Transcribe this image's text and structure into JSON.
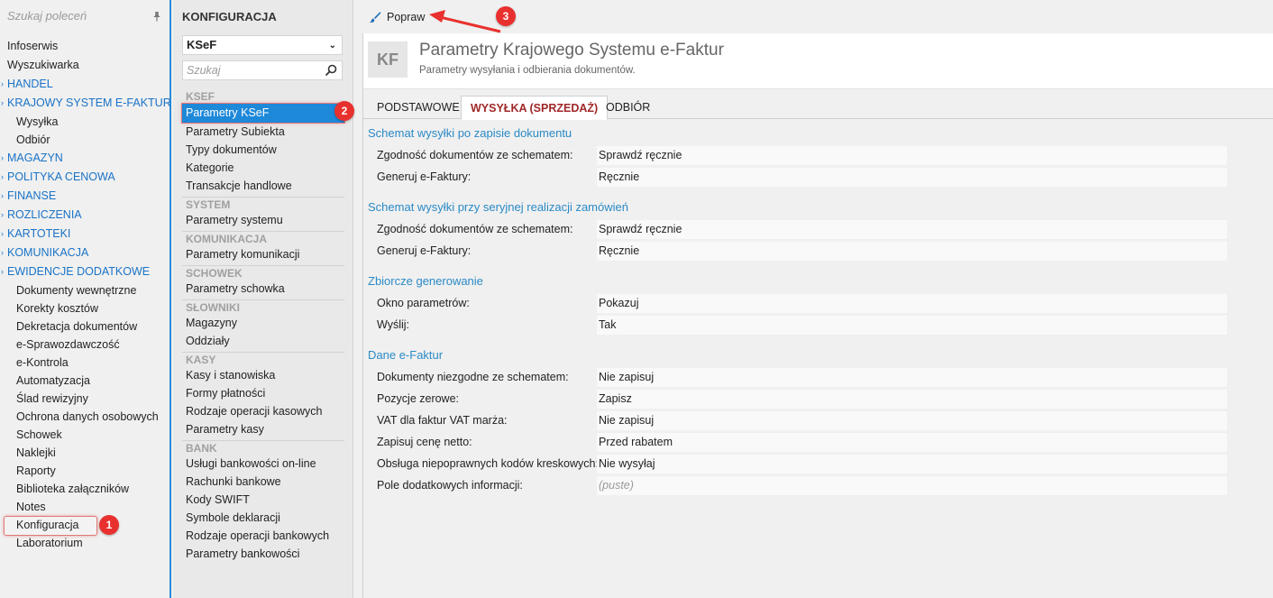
{
  "leftnav": {
    "search_placeholder": "Szukaj poleceń",
    "items": [
      {
        "label": "Infoserwis",
        "kind": "plain"
      },
      {
        "label": "Wyszukiwarka",
        "kind": "plain"
      },
      {
        "label": "HANDEL",
        "kind": "section"
      },
      {
        "label": "KRAJOWY SYSTEM E-FAKTUR",
        "kind": "section"
      },
      {
        "label": "Wysyłka",
        "kind": "sub"
      },
      {
        "label": "Odbiór",
        "kind": "sub"
      },
      {
        "label": "MAGAZYN",
        "kind": "section"
      },
      {
        "label": "POLITYKA CENOWA",
        "kind": "section"
      },
      {
        "label": "FINANSE",
        "kind": "section"
      },
      {
        "label": "ROZLICZENIA",
        "kind": "section"
      },
      {
        "label": "KARTOTEKI",
        "kind": "section"
      },
      {
        "label": "KOMUNIKACJA",
        "kind": "section"
      },
      {
        "label": "EWIDENCJE DODATKOWE",
        "kind": "section"
      },
      {
        "label": "Dokumenty wewnętrzne",
        "kind": "sub"
      },
      {
        "label": "Korekty kosztów",
        "kind": "sub"
      },
      {
        "label": "Dekretacja dokumentów",
        "kind": "sub"
      },
      {
        "label": "e-Sprawozdawczość",
        "kind": "sub"
      },
      {
        "label": "e-Kontrola",
        "kind": "sub"
      },
      {
        "label": "Automatyzacja",
        "kind": "sub"
      },
      {
        "label": "Ślad rewizyjny",
        "kind": "sub"
      },
      {
        "label": "Ochrona danych osobowych",
        "kind": "sub"
      },
      {
        "label": "Schowek",
        "kind": "sub"
      },
      {
        "label": "Naklejki",
        "kind": "sub"
      },
      {
        "label": "Raporty",
        "kind": "sub"
      },
      {
        "label": "Biblioteka załączników",
        "kind": "sub"
      },
      {
        "label": "Notes",
        "kind": "sub"
      },
      {
        "label": "Konfiguracja",
        "kind": "sub"
      },
      {
        "label": "Laboratorium",
        "kind": "sub"
      }
    ]
  },
  "config": {
    "title": "KONFIGURACJA",
    "selected": "KSeF",
    "search_placeholder": "Szukaj",
    "groups": [
      {
        "name": "KSEF",
        "items": [
          "Parametry KSeF",
          "Parametry Subiekta",
          "Typy dokumentów",
          "Kategorie",
          "Transakcje handlowe"
        ]
      },
      {
        "name": "SYSTEM",
        "items": [
          "Parametry systemu"
        ]
      },
      {
        "name": "KOMUNIKACJA",
        "items": [
          "Parametry komunikacji"
        ]
      },
      {
        "name": "SCHOWEK",
        "items": [
          "Parametry schowka"
        ]
      },
      {
        "name": "SŁOWNIKI",
        "items": [
          "Magazyny",
          "Oddziały"
        ]
      },
      {
        "name": "KASY",
        "items": [
          "Kasy i stanowiska",
          "Formy płatności",
          "Rodzaje operacji kasowych",
          "Parametry kasy"
        ]
      },
      {
        "name": "BANK",
        "items": [
          "Usługi bankowości on-line",
          "Rachunki bankowe",
          "Kody SWIFT",
          "Symbole deklaracji",
          "Rodzaje operacji bankowych",
          "Parametry bankowości"
        ]
      }
    ]
  },
  "toolbar": {
    "edit_label": "Popraw"
  },
  "header": {
    "badge": "KF",
    "title": "Parametry Krajowego Systemu e-Faktur",
    "subtitle": "Parametry wysyłania i odbierania dokumentów."
  },
  "tabs": [
    {
      "label": "PODSTAWOWE"
    },
    {
      "label": "WYSYŁKA (SPRZEDAŻ)"
    },
    {
      "label": "ODBIÓR"
    }
  ],
  "sections": [
    {
      "title": "Schemat wysyłki po zapisie dokumentu",
      "rows": [
        {
          "label": "Zgodność dokumentów ze schematem:",
          "value": "Sprawdź ręcznie"
        },
        {
          "label": "Generuj e-Faktury:",
          "value": "Ręcznie"
        }
      ]
    },
    {
      "title": "Schemat wysyłki przy seryjnej realizacji zamówień",
      "rows": [
        {
          "label": "Zgodność dokumentów ze schematem:",
          "value": "Sprawdź ręcznie"
        },
        {
          "label": "Generuj e-Faktury:",
          "value": "Ręcznie"
        }
      ]
    },
    {
      "title": "Zbiorcze generowanie",
      "rows": [
        {
          "label": "Okno parametrów:",
          "value": "Pokazuj"
        },
        {
          "label": "Wyślij:",
          "value": "Tak"
        }
      ]
    },
    {
      "title": "Dane e-Faktur",
      "rows": [
        {
          "label": "Dokumenty niezgodne ze schematem:",
          "value": "Nie zapisuj"
        },
        {
          "label": "Pozycje zerowe:",
          "value": "Zapisz"
        },
        {
          "label": "VAT dla faktur VAT marża:",
          "value": "Nie zapisuj"
        },
        {
          "label": "Zapisuj cenę netto:",
          "value": "Przed rabatem"
        },
        {
          "label": "Obsługa niepoprawnych kodów kreskowych:",
          "value": "Nie wysyłaj"
        },
        {
          "label": "Pole dodatkowych informacji:",
          "value": "(puste)"
        }
      ]
    }
  ],
  "annotations": {
    "b1": "1",
    "b2": "2",
    "b3": "3"
  },
  "colors": {
    "accent": "#1e88d9",
    "section": "#1a73c7",
    "tab_active": "#a02828",
    "badge": "#e8312e"
  }
}
